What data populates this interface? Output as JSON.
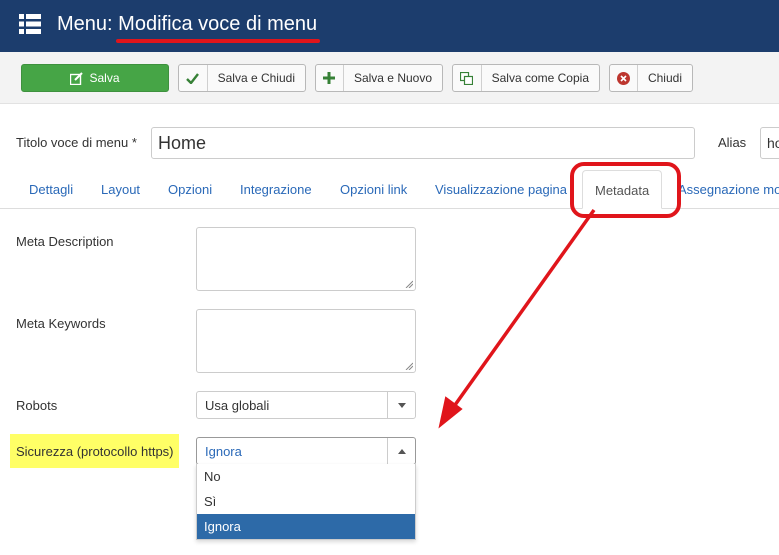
{
  "header": {
    "title_prefix": "Menu: ",
    "title_main": "Modifica voce di menu"
  },
  "toolbar": {
    "save": "Salva",
    "save_close": "Salva e Chiudi",
    "save_new": "Salva e Nuovo",
    "save_copy": "Salva come Copia",
    "close": "Chiudi"
  },
  "form": {
    "title_label": "Titolo voce di menu *",
    "title_value": "Home",
    "alias_label": "Alias",
    "alias_value": "home"
  },
  "tabs": [
    {
      "label": "Dettagli"
    },
    {
      "label": "Layout"
    },
    {
      "label": "Opzioni"
    },
    {
      "label": "Integrazione"
    },
    {
      "label": "Opzioni link"
    },
    {
      "label": "Visualizzazione pagina"
    },
    {
      "label": "Metadata"
    },
    {
      "label": "Assegnazione mo"
    }
  ],
  "active_tab": "Metadata",
  "metadata": {
    "meta_description_label": "Meta Description",
    "meta_keywords_label": "Meta Keywords",
    "robots_label": "Robots",
    "robots_value": "Usa globali",
    "security_label": "Sicurezza (protocollo https)",
    "security_value": "Ignora",
    "security_options": [
      "No",
      "Sì",
      "Ignora"
    ],
    "security_selected": "Ignora"
  },
  "colors": {
    "header_bg": "#1c3d6d",
    "accent_red": "#e0151b",
    "success": "#46a546",
    "link": "#2a69b8",
    "highlight": "#ffff66",
    "selected_option": "#2d6aa8"
  }
}
